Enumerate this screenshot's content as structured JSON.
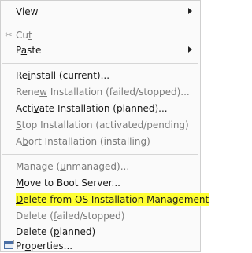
{
  "menu": {
    "items": [
      {
        "pre": "",
        "key": "V",
        "post": "iew",
        "disabled": false,
        "submenu": true
      },
      {
        "pre": "Cu",
        "key": "t",
        "post": "",
        "disabled": true,
        "submenu": false,
        "icon": "scissors-icon"
      },
      {
        "pre": "P",
        "key": "a",
        "post": "ste",
        "disabled": false,
        "submenu": true
      },
      {
        "pre": "Re",
        "key": "i",
        "post": "nstall (current)...",
        "disabled": false,
        "submenu": false
      },
      {
        "pre": "Rene",
        "key": "w",
        "post": " Installation (failed/stopped)...",
        "disabled": true,
        "submenu": false
      },
      {
        "pre": "Acti",
        "key": "v",
        "post": "ate Installation (planned)...",
        "disabled": false,
        "submenu": false
      },
      {
        "pre": "",
        "key": "S",
        "post": "top Installation (activated/pending)",
        "disabled": true,
        "submenu": false
      },
      {
        "pre": "A",
        "key": "b",
        "post": "ort Installation (installing)",
        "disabled": true,
        "submenu": false
      },
      {
        "pre": "Manage (",
        "key": "u",
        "post": "nmanaged)...",
        "disabled": true,
        "submenu": false
      },
      {
        "pre": "",
        "key": "M",
        "post": "ove to Boot Server...",
        "disabled": false,
        "submenu": false
      },
      {
        "pre": "",
        "key": "D",
        "post": "elete from OS Installation Management",
        "disabled": false,
        "submenu": false,
        "highlighted": true
      },
      {
        "pre": "Delete (",
        "key": "f",
        "post": "ailed/stopped)",
        "disabled": true,
        "submenu": false
      },
      {
        "pre": "Delete (",
        "key": "p",
        "post": "lanned)",
        "disabled": false,
        "submenu": false
      },
      {
        "pre": "Pr",
        "key": "o",
        "post": "perties...",
        "disabled": false,
        "submenu": false,
        "icon": "properties-icon"
      }
    ]
  },
  "colors": {
    "highlight": "#ffff33",
    "disabled_text": "#7a7a7a",
    "text": "#1a1a1a"
  }
}
